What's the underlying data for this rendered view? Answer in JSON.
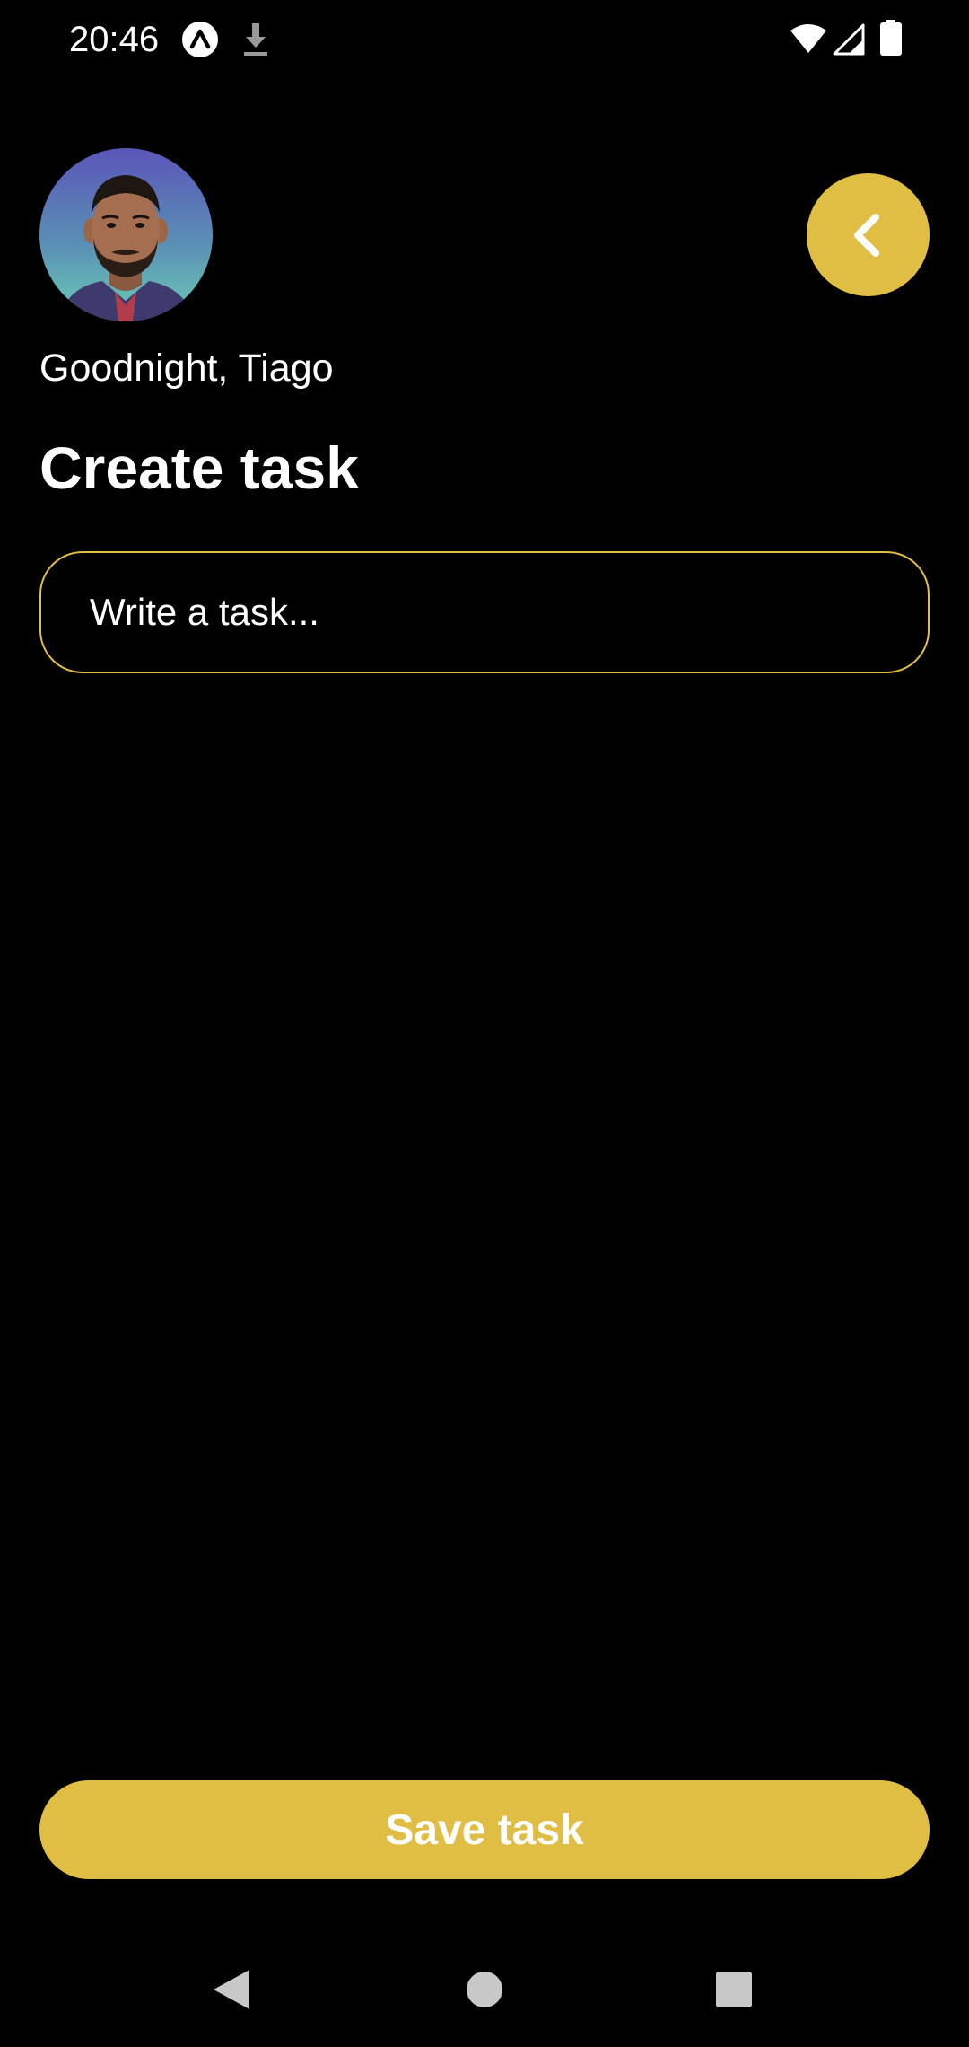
{
  "status_bar": {
    "time": "20:46",
    "icons": [
      "app-notification-icon",
      "download-icon",
      "wifi-icon",
      "cellular-signal-icon",
      "battery-icon"
    ]
  },
  "header": {
    "avatar_icon": "user-avatar-photo",
    "back_icon": "chevron-left-icon",
    "greeting": "Goodnight, Tiago",
    "title": "Create task"
  },
  "task_input": {
    "value": "",
    "placeholder": "Write a task..."
  },
  "actions": {
    "save_label": "Save task"
  },
  "nav_bar": {
    "icons": [
      "nav-back-icon",
      "nav-home-icon",
      "nav-recents-icon"
    ]
  },
  "colors": {
    "background": "#000000",
    "accent": "#e0bd43",
    "text": "#ffffff"
  }
}
